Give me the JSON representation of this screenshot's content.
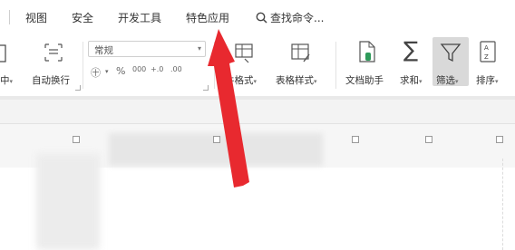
{
  "menu_tabs": [
    "视图",
    "安全",
    "开发工具",
    "特色应用"
  ],
  "search": {
    "label": "查找命令..."
  },
  "ribbon": {
    "left_partial_label": "中",
    "wrap_label": "自动换行",
    "number_format": {
      "value": "常规"
    },
    "number_icons": [
      "㊉",
      "%",
      "000",
      "+.0",
      ".00"
    ],
    "cond_format_label": "件格式",
    "table_style_label": "表格样式",
    "doc_helper_label": "文档助手",
    "sum_label": "求和",
    "filter_label": "筛选",
    "sort_label": "排序"
  },
  "colors": {
    "arrow": "#e8292f",
    "filter_active_bg": "#d9d9d9",
    "doc_helper_icon": "#2e9a5a"
  }
}
